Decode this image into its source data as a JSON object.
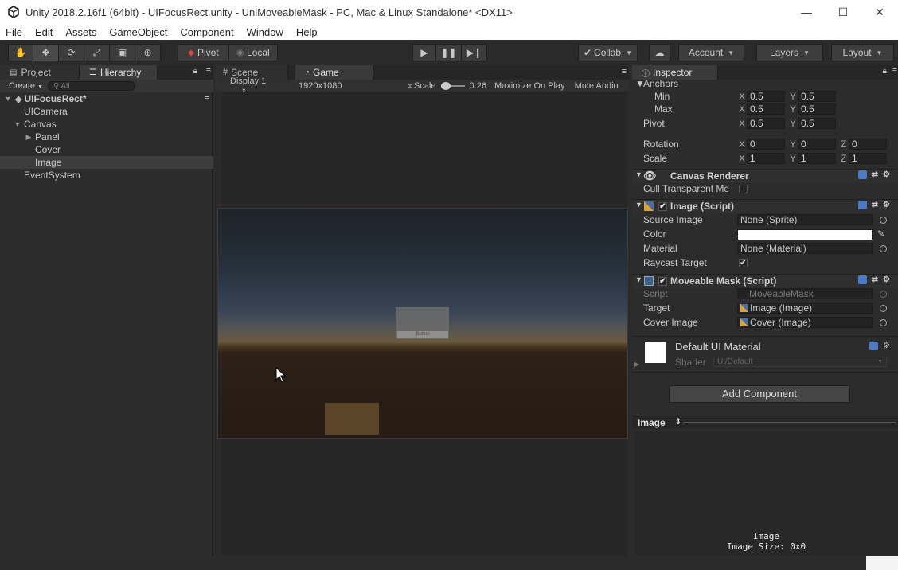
{
  "window": {
    "title": "Unity 2018.2.16f1 (64bit) - UIFocusRect.unity - UniMoveableMask - PC, Mac & Linux Standalone* <DX11>",
    "minimize": "—",
    "maximize": "☐",
    "close": "✕"
  },
  "menu": [
    "File",
    "Edit",
    "Assets",
    "GameObject",
    "Component",
    "Window",
    "Help"
  ],
  "toolbar": {
    "pivot": "Pivot",
    "local": "Local",
    "collab": "Collab",
    "account": "Account",
    "layers": "Layers",
    "layout": "Layout"
  },
  "left_tabs": {
    "project": "Project",
    "hierarchy": "Hierarchy"
  },
  "hierarchy": {
    "create": "Create",
    "search_placeholder": "All",
    "scene_name": "UIFocusRect*",
    "items": [
      "UICamera",
      "Canvas",
      "Panel",
      "Cover",
      "Image",
      "EventSystem"
    ]
  },
  "center_tabs": {
    "scene": "Scene",
    "game": "Game"
  },
  "game_bar": {
    "display": "Display 1",
    "resolution": "1920x1080",
    "scale_label": "Scale",
    "scale_value": "0.26",
    "maximize": "Maximize On Play",
    "mute": "Mute Audio"
  },
  "game_view": {
    "button_label": "Button"
  },
  "inspector": {
    "tab": "Inspector",
    "anchors": "Anchors",
    "min": "Min",
    "max": "Max",
    "pivot": "Pivot",
    "rotation": "Rotation",
    "scale": "Scale",
    "anchor_min_x": "0.5",
    "anchor_min_y": "0.5",
    "anchor_max_x": "0.5",
    "anchor_max_y": "0.5",
    "pivot_x": "0.5",
    "pivot_y": "0.5",
    "rot_x": "0",
    "rot_y": "0",
    "rot_z": "0",
    "scale_x": "1",
    "scale_y": "1",
    "scale_z": "1",
    "canvas_renderer": "Canvas Renderer",
    "cull_transparent": "Cull Transparent Me",
    "image_script": "Image (Script)",
    "source_image_label": "Source Image",
    "source_image_value": "None (Sprite)",
    "color_label": "Color",
    "material_label": "Material",
    "material_value": "None (Material)",
    "raycast_label": "Raycast Target",
    "moveable_mask": "Moveable Mask (Script)",
    "script_label": "Script",
    "script_value": "MoveableMask",
    "target_label": "Target",
    "target_value": "Image (Image)",
    "cover_label": "Cover Image",
    "cover_value": "Cover (Image)",
    "material_name": "Default UI Material",
    "shader_label": "Shader",
    "shader_value": "UI/Default",
    "add_component": "Add Component",
    "preview_title": "Image",
    "preview_name": "Image",
    "preview_size": "Image Size: 0x0"
  },
  "colors": {
    "accent": "#4a7bc4",
    "editor_bg": "#2c2c2c"
  }
}
